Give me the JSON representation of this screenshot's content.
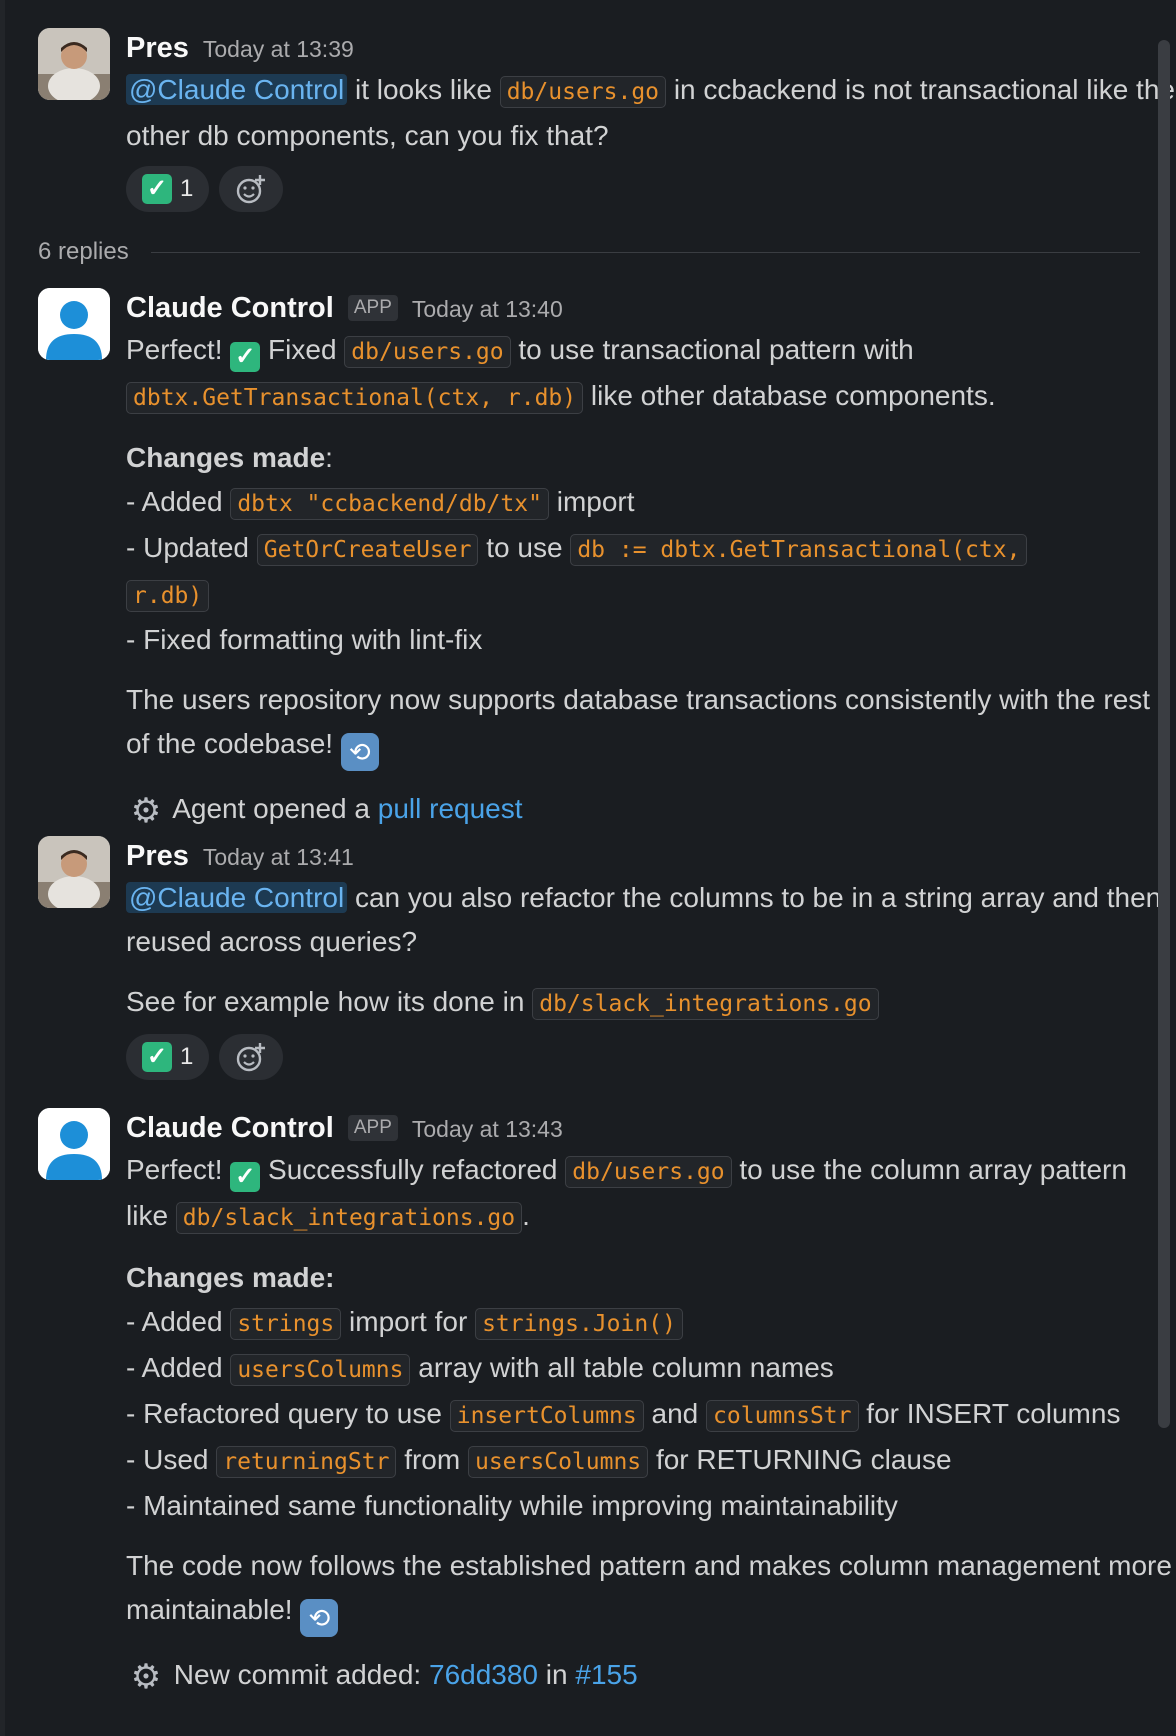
{
  "messages": [
    {
      "author": "Pres",
      "time": "Today at 13:39",
      "mention": "@Claude Control",
      "t1": "it looks like",
      "code1": "db/users.go",
      "t2": "in ccbackend is not transactional like the other db components, can you fix that?",
      "reaction_count": "1"
    },
    {
      "author": "Claude Control",
      "badge": "APP",
      "time": "Today at 13:40",
      "intro_a": "Perfect!",
      "intro_b": "Fixed",
      "intro_code1": "db/users.go",
      "intro_c": "to use transactional pattern with",
      "intro_code2": "dbtx.GetTransactional(ctx, r.db)",
      "intro_d": "like other database components.",
      "changes_title": "Changes made",
      "changes_colon": ":",
      "c1_a": "- Added",
      "c1_code": "dbtx \"ccbackend/db/tx\"",
      "c1_b": "import",
      "c2_a": "- Updated",
      "c2_code1": "GetOrCreateUser",
      "c2_b": "to use",
      "c2_code2a": "db := dbtx.GetTransactional(ctx,",
      "c2_code2b": "r.db)",
      "c3": "- Fixed formatting with lint-fix",
      "outro": "The users repository now supports database transactions consistently with the rest of the codebase!",
      "footer_a": "Agent opened a",
      "footer_link": "pull request"
    },
    {
      "author": "Pres",
      "time": "Today at 13:41",
      "mention": "@Claude Control",
      "t1": "can you also refactor the columns to be in a string array and then reused across queries?",
      "t2": "See for example how its done in",
      "code1": "db/slack_integrations.go",
      "reaction_count": "1"
    },
    {
      "author": "Claude Control",
      "badge": "APP",
      "time": "Today at 13:43",
      "intro_a": "Perfect!",
      "intro_b": "Successfully refactored",
      "intro_code1": "db/users.go",
      "intro_c": "to use the column array pattern like",
      "intro_code2": "db/slack_integrations.go",
      "intro_d": ".",
      "changes_title": "Changes made:",
      "c1_a": "- Added",
      "c1_code1": "strings",
      "c1_b": "import for",
      "c1_code2": "strings.Join()",
      "c2_a": "- Added",
      "c2_code": "usersColumns",
      "c2_b": "array with all table column names",
      "c3_a": "- Refactored query to use",
      "c3_code1": "insertColumns",
      "c3_b": "and",
      "c3_code2": "columnsStr",
      "c3_c": "for INSERT columns",
      "c4_a": "- Used",
      "c4_code1": "returningStr",
      "c4_b": "from",
      "c4_code2": "usersColumns",
      "c4_c": "for RETURNING clause",
      "c5": "- Maintained same functionality while improving maintainability",
      "outro": "The code now follows the established pattern and makes column management more maintainable!",
      "footer_a": "New commit added:",
      "footer_link1": "76dd380",
      "footer_b": "in",
      "footer_link2": "#155"
    }
  ],
  "thread": {
    "replies": "6 replies"
  },
  "icons": {
    "check": "white-check-mark-icon",
    "sync": "arrows-counterclockwise-icon",
    "gear": "gear-icon",
    "add_reaction": "add-reaction-icon"
  }
}
